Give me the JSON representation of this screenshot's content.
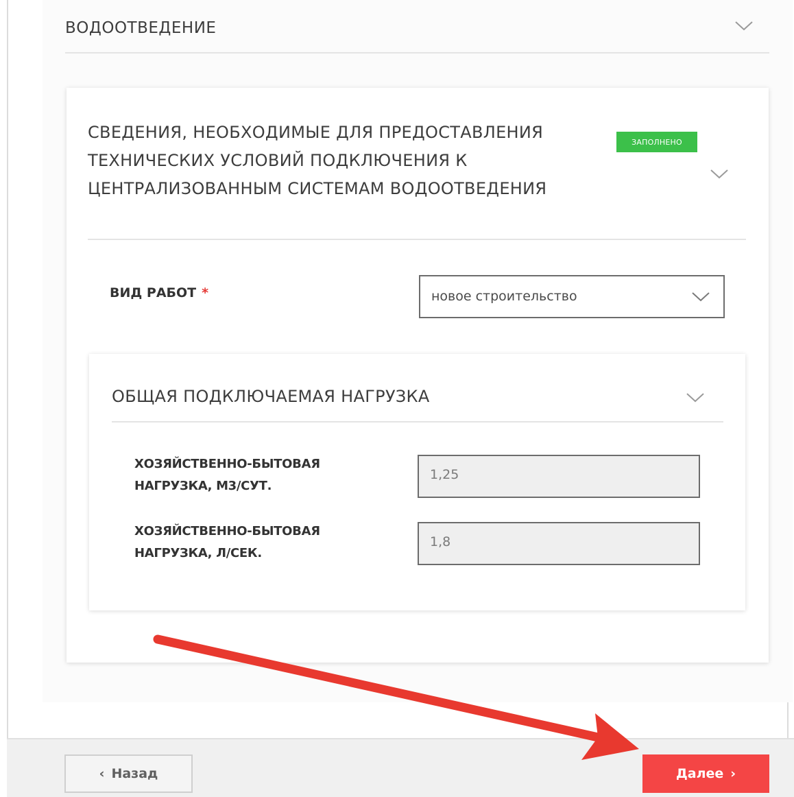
{
  "section": {
    "title": "ВОДООТВЕДЕНИЕ"
  },
  "info_card": {
    "title": "СВЕДЕНИЯ, НЕОБХОДИМЫЕ ДЛЯ ПРЕДОСТАВЛЕНИЯ ТЕХНИЧЕСКИХ УСЛОВИЙ ПОДКЛЮЧЕНИЯ К ЦЕНТРАЛИЗОВАННЫМ СИСТЕМАМ ВОДООТВЕДЕНИЯ",
    "status_badge": "ЗАПОЛНЕНО",
    "status_color": "#3cc04a"
  },
  "work_type": {
    "label": "ВИД РАБОТ",
    "required_mark": "*",
    "selected_value": "новое строительство"
  },
  "load_card": {
    "title": "ОБЩАЯ ПОДКЛЮЧАЕМАЯ НАГРУЗКА",
    "fields": [
      {
        "label": "ХОЗЯЙСТВЕННО-БЫТОВАЯ НАГРУЗКА, М3/СУТ.",
        "value": "1,25"
      },
      {
        "label": "ХОЗЯЙСТВЕННО-БЫТОВАЯ НАГРУЗКА, Л/СЕК.",
        "value": "1,8"
      }
    ]
  },
  "footer": {
    "back_label": "Назад",
    "back_arrow": "‹",
    "next_label": "Далее",
    "next_arrow": "›",
    "next_color": "#f44545"
  },
  "icons": {
    "chevron": "chevron-down-icon",
    "annotation": "red-arrow"
  }
}
